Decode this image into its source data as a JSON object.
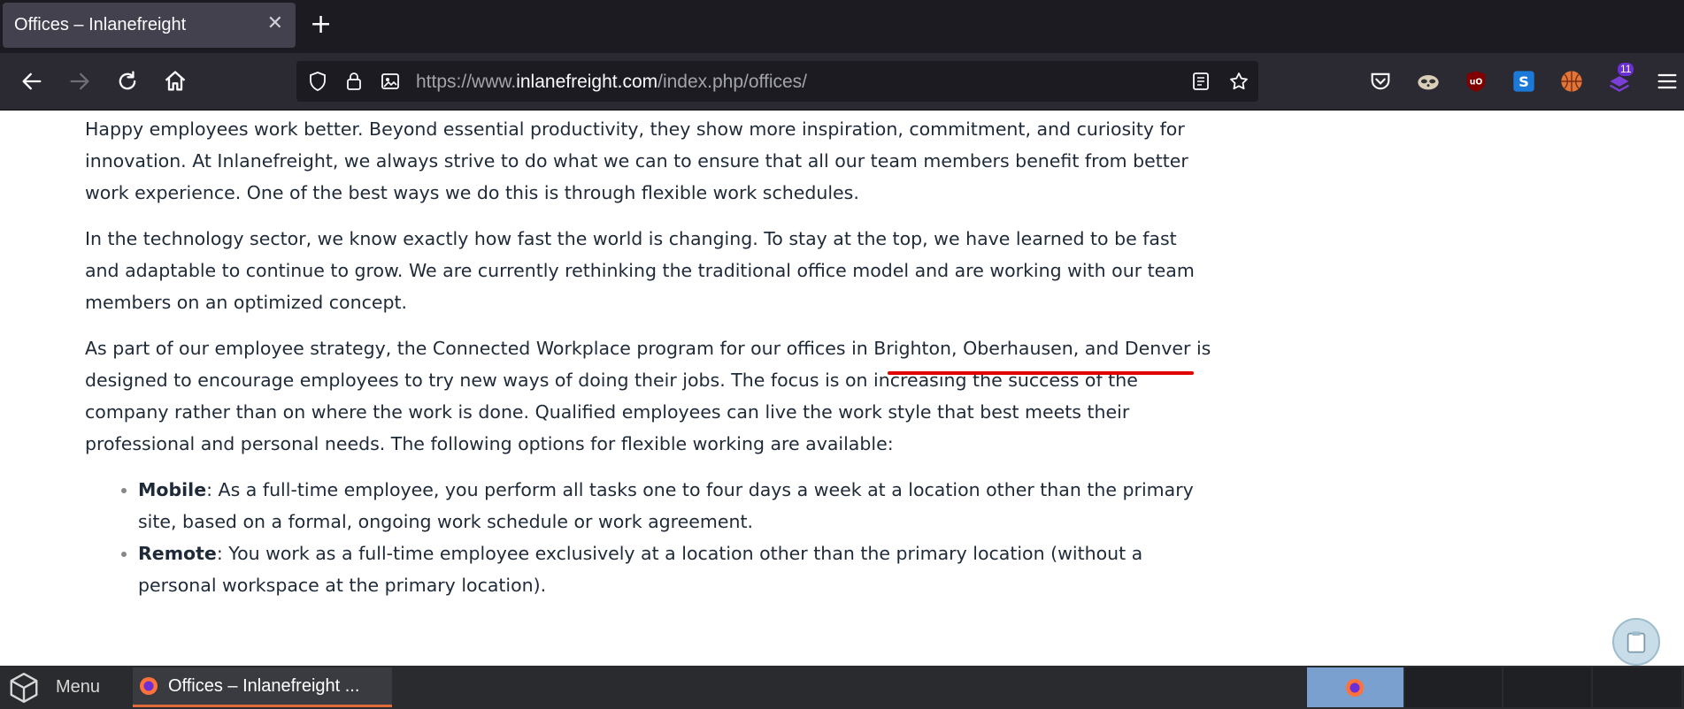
{
  "browser": {
    "tab_title": "Offices – Inlanefreight",
    "tab_close": "✕",
    "new_tab": "+",
    "url_prefix": "https://www.",
    "url_domain": "inlanefreight.com",
    "url_path": "/index.php/offices/",
    "extension_badge": "11"
  },
  "page": {
    "paragraphs": [
      "Happy employees work better. Beyond essential productivity, they show more inspiration, commitment, and curiosity for innovation. At Inlanefreight, we always strive to do what we can to ensure that all our team members benefit from better work experience. One of the best ways we do this is through flexible work schedules.",
      "In the technology sector, we know exactly how fast the world is changing. To stay at the top, we have learned to be fast and adaptable to continue to grow. We are currently rethinking the traditional office model and are working with our team members on an optimized concept."
    ],
    "p3_before": "As part of our employee strategy, the Connected Workplace program for our offices in ",
    "p3_highlight": "Brighton, Oberhausen, and Denver",
    "p3_after": " is designed to encourage employees to try new ways of doing their jobs. The focus is on increasing the success of the company rather than on where the work is done. Qualified employees can live the work style that best meets their professional and personal needs. The following options for flexible working are available:",
    "list": [
      {
        "term": "Mobile",
        "text": ": As a full-time employee, you perform all tasks one to four days a week at a location other than the primary site, based on a formal, ongoing work schedule or work agreement."
      },
      {
        "term": "Remote",
        "text": ": You work as a full-time employee exclusively at a location other than the primary location (without a personal workspace at the primary location)."
      }
    ]
  },
  "taskbar": {
    "menu_label": "Menu",
    "task_label": "Offices – Inlanefreight ..."
  },
  "colors": {
    "annotation": "#e00000",
    "chrome_dark": "#1c1b22",
    "text": "#1f2a38"
  }
}
